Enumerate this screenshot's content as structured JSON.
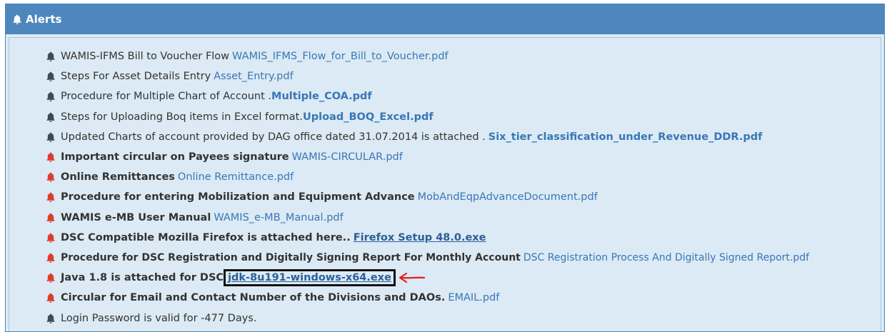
{
  "header": {
    "title": "Alerts",
    "icon": "bell-icon"
  },
  "colors": {
    "header_bg": "#4d87bd",
    "body_bg": "#dbeaf4",
    "link": "#3a76b6",
    "bell_normal": "#3d4a57",
    "bell_urgent": "#e03a2f",
    "annotation": "#e02020"
  },
  "alerts": [
    {
      "text": "WAMIS-IFMS Bill to Voucher Flow",
      "link": "WAMIS_IFMS_Flow_for_Bill_to_Voucher.pdf",
      "urgent": false
    },
    {
      "text": "Steps For Asset Details Entry",
      "link": "Asset_Entry.pdf",
      "urgent": false
    },
    {
      "text": "Procedure for Multiple Chart of Account .",
      "link": "Multiple_COA.pdf",
      "urgent": false
    },
    {
      "text": "Steps for Uploading Boq items in Excel format.",
      "link": "Upload_BOQ_Excel.pdf",
      "urgent": false
    },
    {
      "text": "Updated Charts of account provided by DAG office dated 31.07.2014 is attached .",
      "link": "Six_tier_classification_under_Revenue_DDR.pdf",
      "urgent": false
    },
    {
      "text": "Important circular on Payees signature",
      "link": "WAMIS-CIRCULAR.pdf",
      "urgent": true
    },
    {
      "text": "Online Remittances",
      "link": "Online Remittance.pdf",
      "urgent": true
    },
    {
      "text": "Procedure for entering Mobilization and Equipment Advance",
      "link": "MobAndEqpAdvanceDocument.pdf",
      "urgent": true
    },
    {
      "text": "WAMIS e-MB User Manual",
      "link": "WAMIS_e-MB_Manual.pdf",
      "urgent": true
    },
    {
      "text": "DSC Compatible Mozilla Firefox is attached here..",
      "link": "Firefox Setup 48.0.exe",
      "urgent": true
    },
    {
      "text": "Procedure for DSC Registration and Digitally Signing Report For Monthly Account",
      "link": "DSC Registration Process And Digitally Signed Report.pdf",
      "urgent": true
    },
    {
      "text": "Java 1.8 is attached for DSC",
      "link": "jdk-8u191-windows-x64.exe",
      "urgent": true
    },
    {
      "text": "Circular for Email and Contact Number of the Divisions and DAOs.",
      "link": "EMAIL.pdf",
      "urgent": true
    },
    {
      "text": "Login Password is valid for -477 Days.",
      "link": "",
      "urgent": false
    }
  ]
}
